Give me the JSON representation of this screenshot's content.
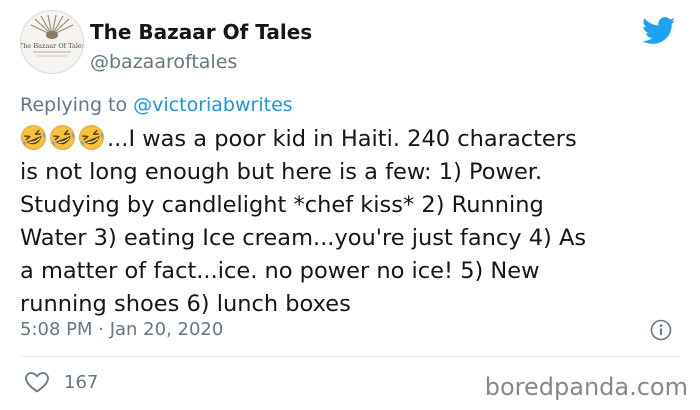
{
  "tweet": {
    "author_name": "The Bazaar Of Tales",
    "author_handle": "@bazaaroftales",
    "avatar_text": "The Bazaar Of Tales",
    "replying_to_prefix": "Replying to ",
    "replying_to_handle": "@victoriabwrites",
    "emoji_count": 3,
    "body_lines": [
      "...I was a poor kid in Haiti. 240 characters",
      "is not long enough but here is a few: 1) Power.",
      "Studying by candlelight  *chef kiss* 2) Running",
      "Water 3) eating Ice cream...you're just fancy  4) As",
      "a matter of fact...ice. no power no ice! 5) New",
      "running shoes 6) lunch boxes"
    ],
    "timestamp": "5:08 PM · Jan 20, 2020",
    "like_count": "167"
  },
  "watermark": "boredpanda.com",
  "colors": {
    "twitter_blue": "#1da1f2",
    "mention_blue": "#1b95e0",
    "secondary_text": "#657786"
  },
  "icons": {
    "logo": "twitter-bird-icon",
    "info": "info-icon",
    "like": "heart-icon",
    "emoji": "rolling-on-floor-laughing-emoji"
  }
}
